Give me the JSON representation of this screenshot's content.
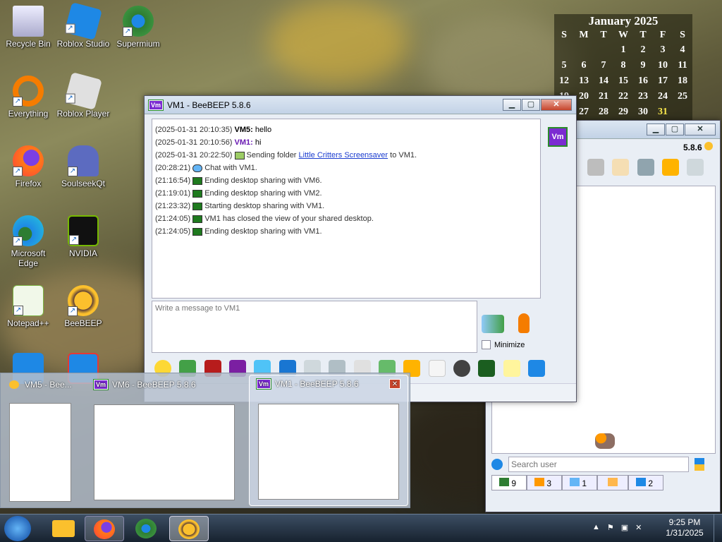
{
  "desktop_icons": [
    {
      "label": "Recycle Bin",
      "icon": "recycle-bin-icon"
    },
    {
      "label": "Roblox Studio",
      "icon": "roblox-studio-icon"
    },
    {
      "label": "Supermium",
      "icon": "supermium-icon"
    },
    {
      "label": "Everything",
      "icon": "everything-icon"
    },
    {
      "label": "Roblox Player",
      "icon": "roblox-player-icon"
    },
    {
      "label": "Firefox",
      "icon": "firefox-icon"
    },
    {
      "label": "SoulseekQt",
      "icon": "soulseek-icon"
    },
    {
      "label": "Microsoft Edge",
      "icon": "edge-icon"
    },
    {
      "label": "NVIDIA",
      "icon": "nvidia-icon"
    },
    {
      "label": "Notepad++",
      "icon": "notepadpp-icon"
    },
    {
      "label": "BeeBEEP",
      "icon": "beebeep-icon"
    }
  ],
  "calendar": {
    "title": "January 2025",
    "days": [
      "S",
      "M",
      "T",
      "W",
      "T",
      "F",
      "S"
    ],
    "weeks": [
      [
        "",
        "",
        "",
        "1",
        "2",
        "3",
        "4"
      ],
      [
        "5",
        "6",
        "7",
        "8",
        "9",
        "10",
        "11"
      ],
      [
        "12",
        "13",
        "14",
        "15",
        "16",
        "17",
        "18"
      ],
      [
        "19",
        "20",
        "21",
        "22",
        "23",
        "24",
        "25"
      ],
      [
        "26",
        "27",
        "28",
        "29",
        "30",
        "31",
        ""
      ]
    ],
    "today": "31"
  },
  "chat_window": {
    "title": "VM1 - BeeBEEP 5.8.6",
    "avatar": "Vm",
    "messages": [
      {
        "time": "(2025-01-31 20:10:35)",
        "user": "VM5:",
        "text": "hello",
        "kind": "u5"
      },
      {
        "time": "(2025-01-31 20:10:56)",
        "user": "VM1:",
        "text": "hi",
        "kind": "u1"
      },
      {
        "time": "(2025-01-31 20:22:50)",
        "pre": "Sending folder",
        "link": "Little Critters Screensaver",
        "post": "to VM1.",
        "kind": "folder"
      },
      {
        "time": "(20:28:21)",
        "text": "Chat with VM1.",
        "kind": "chat"
      },
      {
        "time": "(21:16:54)",
        "text": "Ending desktop sharing with VM6.",
        "kind": "share"
      },
      {
        "time": "(21:19:01)",
        "text": "Ending desktop sharing with VM2.",
        "kind": "share"
      },
      {
        "time": "(21:23:32)",
        "text": "Starting desktop sharing with VM1.",
        "kind": "share"
      },
      {
        "time": "(21:24:05)",
        "text": "VM1 has closed the view of your shared desktop.",
        "kind": "share"
      },
      {
        "time": "(21:24:05)",
        "text": "Ending desktop sharing with VM1.",
        "kind": "share"
      }
    ],
    "input_placeholder": "Write a message to VM1",
    "minimize_label": "Minimize"
  },
  "main_window": {
    "version": "5.8.6",
    "search_placeholder": "Search user",
    "tabs": [
      {
        "count": "9",
        "icon": "users-online-icon"
      },
      {
        "count": "3",
        "icon": "groups-icon"
      },
      {
        "count": "1",
        "icon": "chats-icon"
      },
      {
        "count": "",
        "icon": "shares-icon"
      },
      {
        "count": "2",
        "icon": "network-icon"
      }
    ]
  },
  "taskbar_previews": [
    {
      "title": "VM5 - Bee...",
      "icon": "beebeep-icon"
    },
    {
      "title": "VM6 - BeeBEEP 5.8.6",
      "icon": "vm-icon"
    },
    {
      "title": "VM1 - BeeBEEP 5.8.6",
      "icon": "vm-icon"
    }
  ],
  "clock": {
    "time": "9:25 PM",
    "date": "1/31/2025"
  }
}
